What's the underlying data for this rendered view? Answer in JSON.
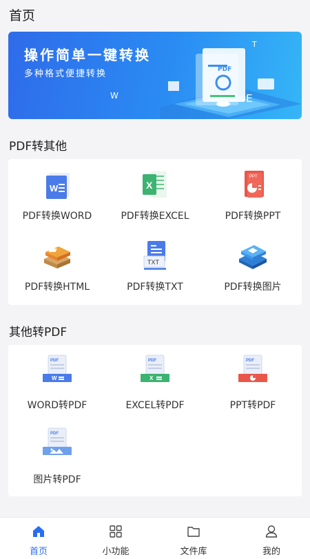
{
  "header": {
    "title": "首页"
  },
  "banner": {
    "title": "操作简单一键转换",
    "subtitle": "多种格式便捷转换",
    "illustration_text": {
      "doc": "PDF",
      "w": "W",
      "e": "E",
      "t": "T"
    }
  },
  "pdf_to_other": {
    "title": "PDF转其他",
    "items": [
      {
        "label": "PDF转换WORD",
        "icon": "word-doc-icon",
        "color": "#4a7be8",
        "glyph": "W"
      },
      {
        "label": "PDF转换EXCEL",
        "icon": "excel-doc-icon",
        "color": "#3cb371",
        "glyph": "X"
      },
      {
        "label": "PDF转换PPT",
        "icon": "ppt-doc-icon",
        "color": "#e8574a",
        "glyph": "PPT"
      },
      {
        "label": "PDF转换HTML",
        "icon": "html-stack-icon",
        "color": "#e88a2e",
        "glyph": ""
      },
      {
        "label": "PDF转换TXT",
        "icon": "txt-doc-icon",
        "color": "#4a7be8",
        "glyph": "TXT"
      },
      {
        "label": "PDF转换图片",
        "icon": "image-stack-icon",
        "color": "#3a95e8",
        "glyph": ""
      }
    ]
  },
  "other_to_pdf": {
    "title": "其他转PDF",
    "items": [
      {
        "label": "WORD转PDF",
        "icon": "word-to-pdf-icon",
        "color": "#4a7be8",
        "glyph": "PDF"
      },
      {
        "label": "EXCEL转PDF",
        "icon": "excel-to-pdf-icon",
        "color": "#3cb371",
        "glyph": "PDF"
      },
      {
        "label": "PPT转PDF",
        "icon": "ppt-to-pdf-icon",
        "color": "#e8574a",
        "glyph": "PDF"
      },
      {
        "label": "图片转PDF",
        "icon": "image-to-pdf-icon",
        "color": "#4a8be8",
        "glyph": "PDF"
      }
    ]
  },
  "tabbar": {
    "items": [
      {
        "label": "首页",
        "icon": "home-icon",
        "active": true
      },
      {
        "label": "小功能",
        "icon": "grid-icon",
        "active": false
      },
      {
        "label": "文件库",
        "icon": "folder-icon",
        "active": false
      },
      {
        "label": "我的",
        "icon": "user-icon",
        "active": false
      }
    ]
  },
  "colors": {
    "accent": "#2a6df0",
    "banner_start": "#2f6bea",
    "banner_end": "#35b6f7"
  }
}
